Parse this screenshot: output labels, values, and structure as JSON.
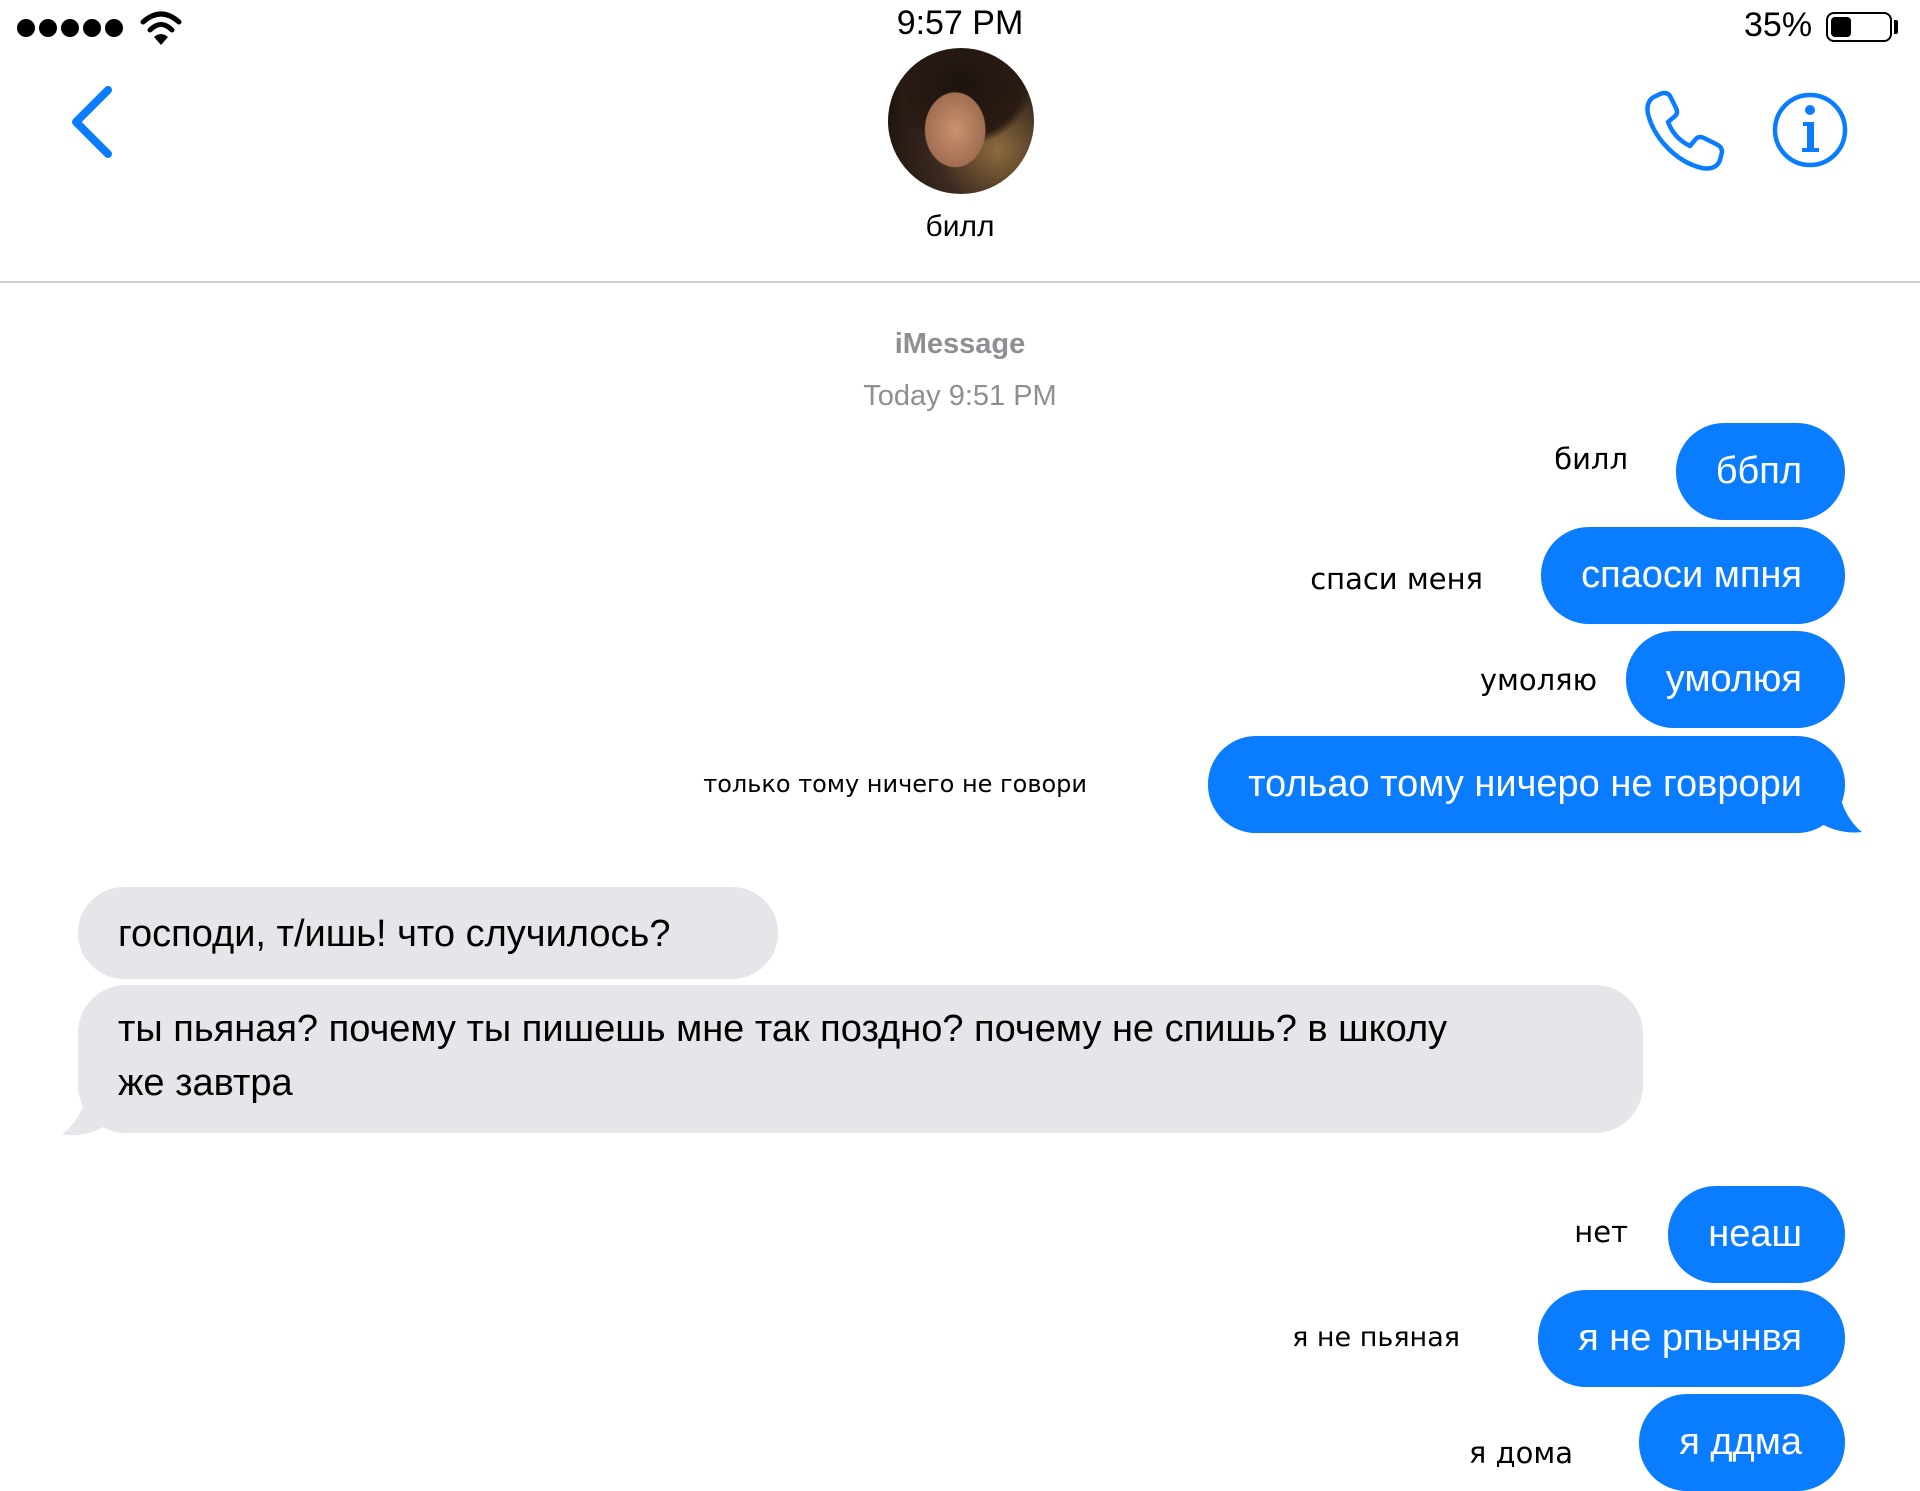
{
  "status_bar": {
    "time": "9:57 PM",
    "battery_percent": "35%",
    "battery_level": 0.35,
    "signal_bars": 5,
    "icons": [
      "signal-dots-icon",
      "wifi-icon",
      "battery-icon"
    ]
  },
  "header": {
    "contact_name": "билл",
    "icons": [
      "back-chevron-icon",
      "avatar",
      "phone-icon",
      "info-icon"
    ],
    "accent_color": "#0a7cff"
  },
  "conversation": {
    "service": "iMessage",
    "timestamp": "Today 9:51 PM",
    "outgoing_1": {
      "text": "ббпл",
      "note": "билл"
    },
    "outgoing_2": {
      "text": "спаоси мпня",
      "note": "спаси меня"
    },
    "outgoing_3": {
      "text": "умолюя",
      "note": "умоляю"
    },
    "outgoing_4": {
      "text": "тольао тому ничеро не говрори",
      "note": "только тому ничего не говори"
    },
    "incoming_1": {
      "text": "господи, т/ишь! что случилось?"
    },
    "incoming_2": {
      "line1": "ты пьяная? почему ты пишешь мне так поздно? почему не спишь? в школу",
      "line2": "же завтра"
    },
    "outgoing_5": {
      "text": "неаш",
      "note": "нет"
    },
    "outgoing_6": {
      "text": "я не рпьчнвя",
      "note": "я не пьяная"
    },
    "outgoing_7": {
      "text": "я ддма",
      "note": "я дома"
    },
    "colors": {
      "outgoing": "#0a7cff",
      "incoming": "#e5e5ea",
      "meta": "#8e8e93"
    }
  }
}
